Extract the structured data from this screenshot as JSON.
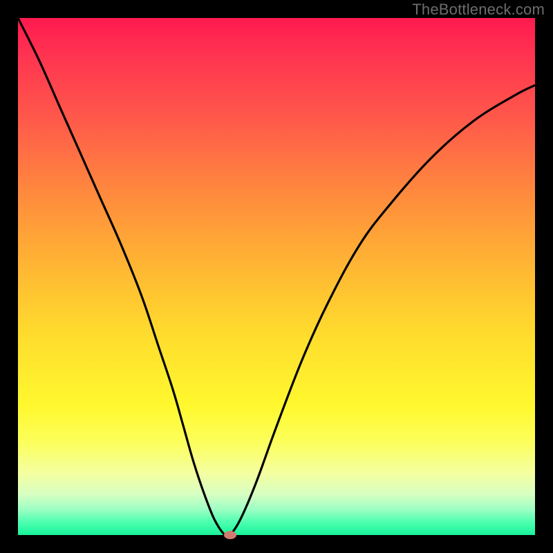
{
  "watermark": "TheBottleneck.com",
  "chart_data": {
    "type": "line",
    "title": "",
    "xlabel": "",
    "ylabel": "",
    "xlim": [
      0,
      100
    ],
    "ylim": [
      0,
      100
    ],
    "grid": false,
    "legend": false,
    "background_gradient": {
      "top": "#ff1a4f",
      "mid": "#ffde2d",
      "bottom": "#17f39a"
    },
    "series": [
      {
        "name": "bottleneck-curve",
        "color": "#000000",
        "x": [
          0,
          4,
          8,
          12,
          16,
          20,
          24,
          27,
          30,
          32,
          34,
          36,
          38,
          40,
          41,
          43,
          46,
          50,
          55,
          60,
          66,
          72,
          80,
          88,
          96,
          100
        ],
        "y": [
          100,
          92,
          83,
          74,
          65,
          56,
          46,
          37,
          28,
          21,
          14,
          8,
          3,
          0,
          0,
          3,
          10,
          21,
          34,
          45,
          56,
          64,
          73,
          80,
          85,
          87
        ]
      }
    ],
    "marker": {
      "x": 41,
      "y": 0,
      "color": "#d17a6e"
    }
  }
}
